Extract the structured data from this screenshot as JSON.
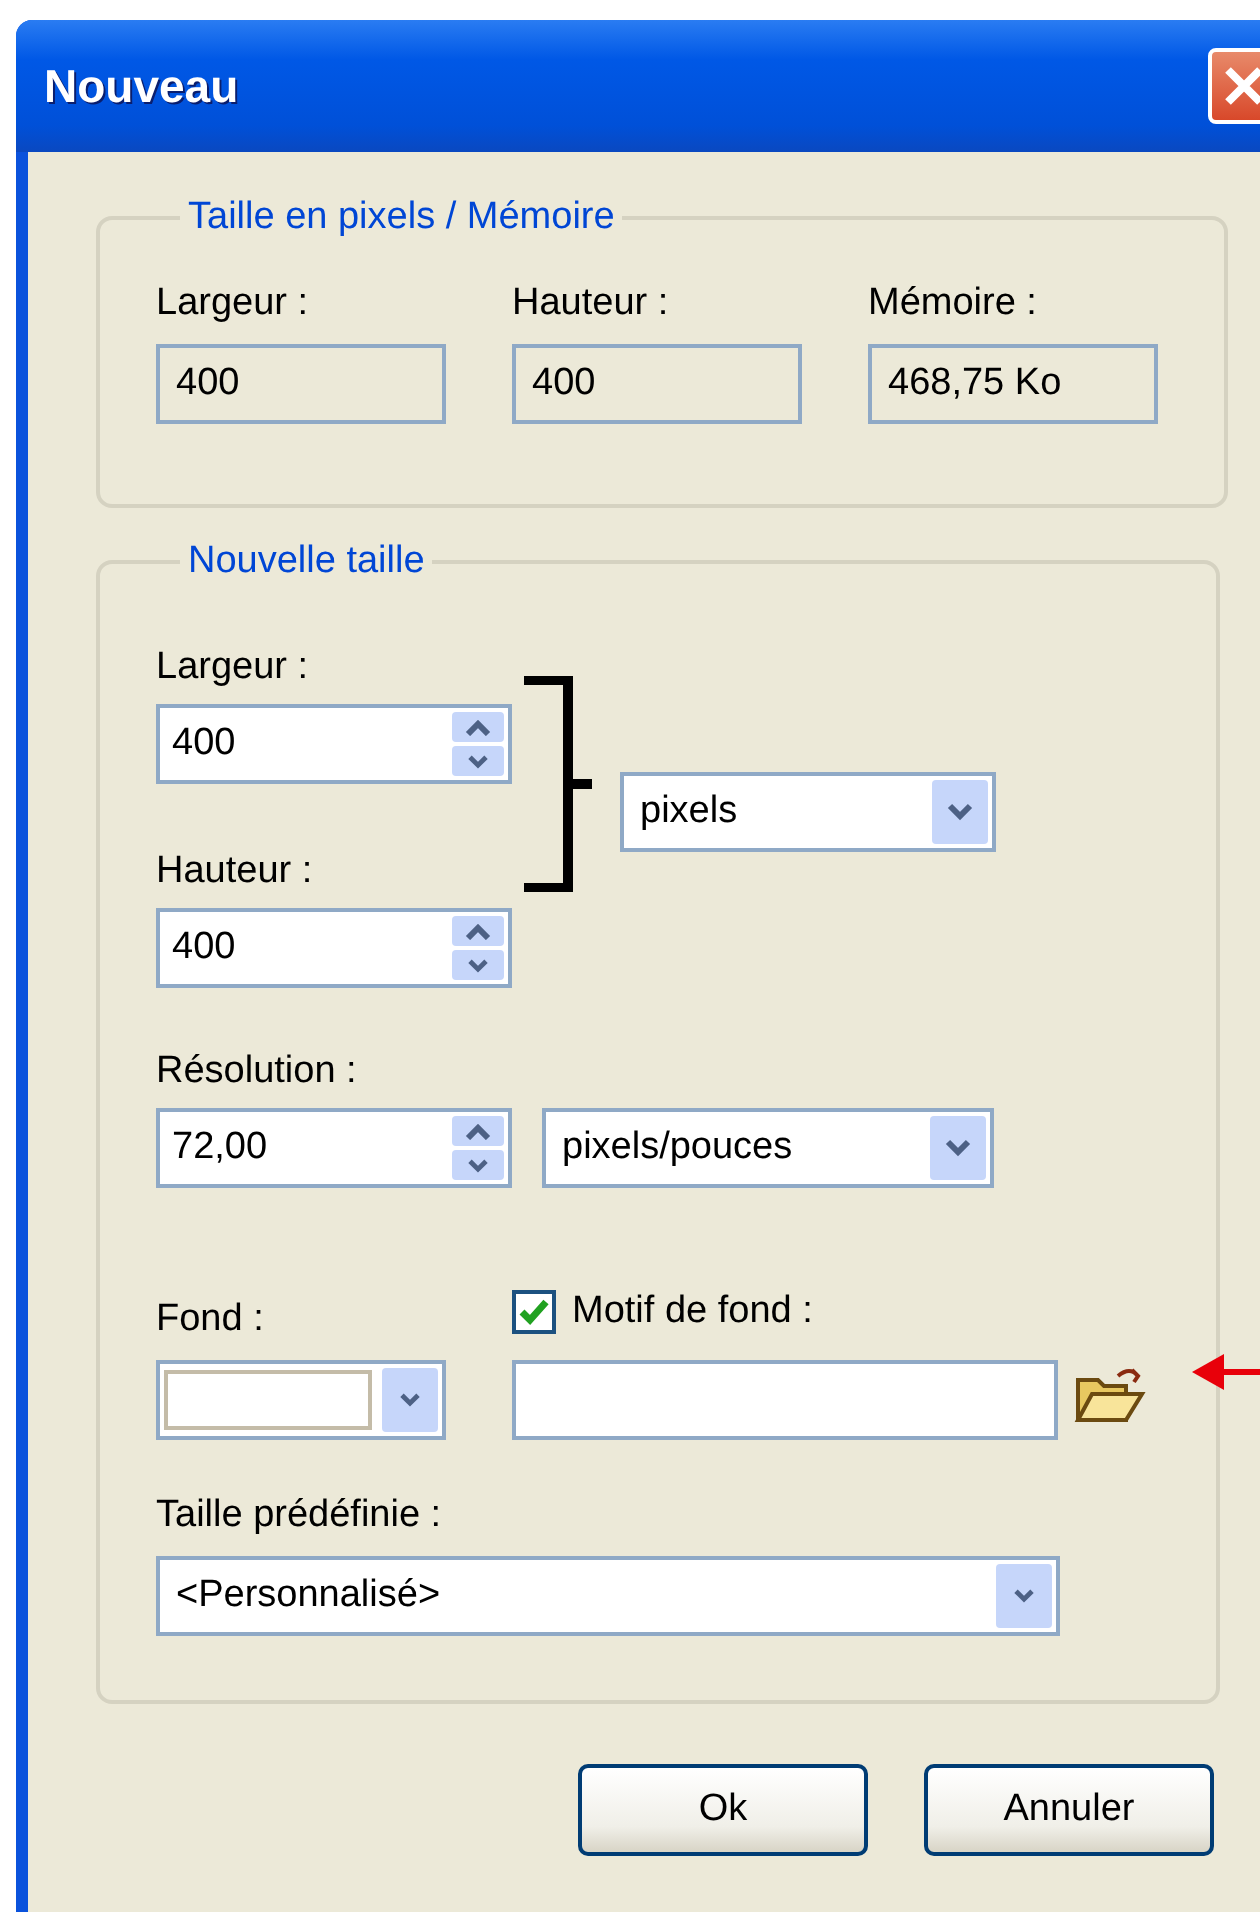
{
  "window": {
    "title": "Nouveau"
  },
  "pixel_memory": {
    "legend": "Taille en pixels / Mémoire",
    "fields": [
      {
        "label": "Largeur :",
        "value": "400"
      },
      {
        "label": "Hauteur :",
        "value": "400"
      },
      {
        "label": "Mémoire :",
        "value": "468,75 Ko"
      }
    ]
  },
  "new_size": {
    "legend": "Nouvelle taille",
    "width": {
      "label": "Largeur :",
      "value": "400"
    },
    "height": {
      "label": "Hauteur :",
      "value": "400"
    },
    "unit": "pixels",
    "resolution": {
      "label": "Résolution :",
      "value": "72,00",
      "unit": "pixels/pouces"
    },
    "background": {
      "label": "Fond :"
    },
    "pattern": {
      "label": "Motif de fond :",
      "checked": true
    },
    "preset": {
      "label": "Taille prédéfinie :",
      "value": "<Personnalisé>"
    }
  },
  "buttons": [
    "Ok",
    "Annuler"
  ]
}
